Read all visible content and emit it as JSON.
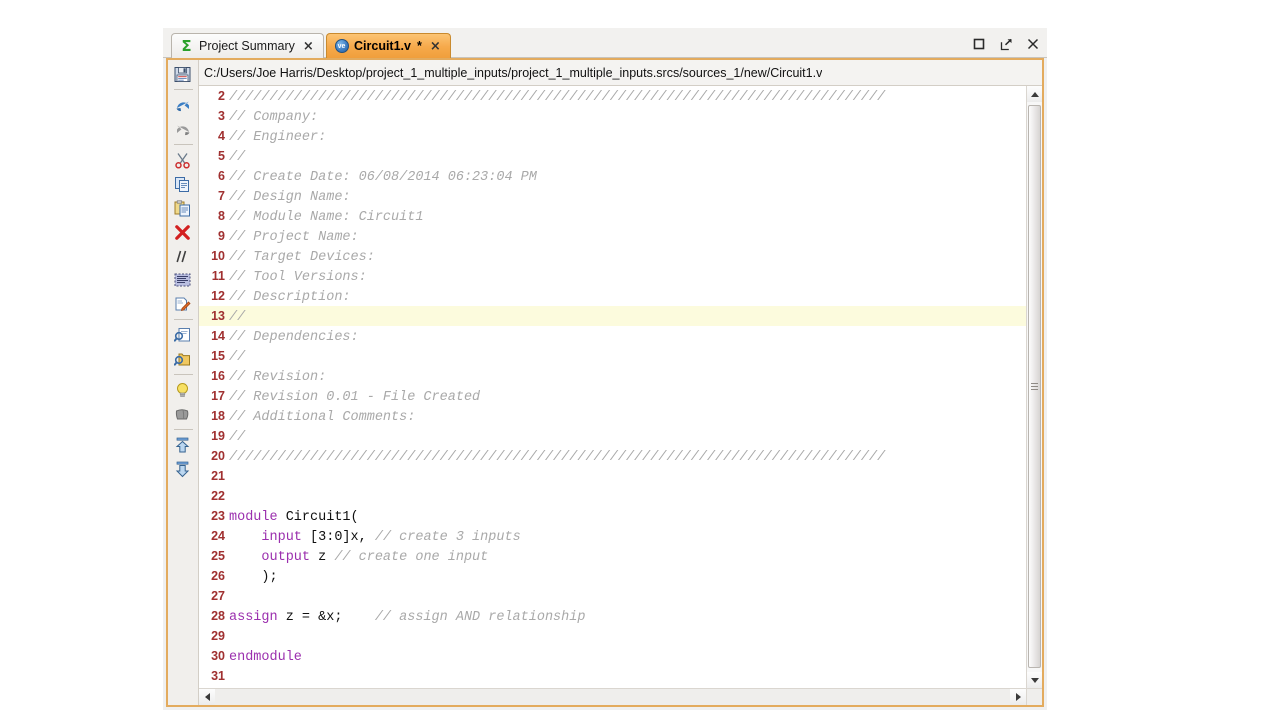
{
  "window": {
    "controls": [
      {
        "name": "maximize",
        "glyph": "maximize-icon"
      },
      {
        "name": "float",
        "glyph": "float-icon"
      },
      {
        "name": "close",
        "glyph": "close-icon"
      }
    ]
  },
  "tabs": [
    {
      "label": "Project Summary",
      "icon": "sigma-icon",
      "dirty": "",
      "close": "×",
      "active": false
    },
    {
      "label": "Circuit1.v",
      "icon": "verilog-icon",
      "icon_text": "ve",
      "dirty": "*",
      "close": "×",
      "active": true
    }
  ],
  "path_bar": {
    "path": "C:/Users/Joe Harris/Desktop/project_1_multiple_inputs/project_1_multiple_inputs.srcs/sources_1/new/Circuit1.v",
    "save_icon": "save-icon"
  },
  "side_toolbar": {
    "items": [
      "undo-icon",
      "redo-icon",
      "cut-icon",
      "copy-icon",
      "paste-icon",
      "delete-icon",
      "comment-icon",
      "block-select-icon",
      "edit-icon",
      "find-icon",
      "find-in-files-icon",
      "hint-icon",
      "eraser-icon",
      "collapse-all-icon",
      "expand-all-icon"
    ]
  },
  "colors": {
    "accent_tab": "#f6a94a",
    "panel_border": "#e3ab5e",
    "line_number": "#a03030",
    "comment": "#a9a9a9",
    "keyword": "#9b2fae",
    "plain": "#101010",
    "current_line_highlight": "#fcfbdd",
    "verilog_icon": "#3f7fc4",
    "sigma_icon": "#2aa02a"
  },
  "editor": {
    "language": "verilog",
    "current_line": 13,
    "first_visible_line": 2,
    "last_visible_line": 31,
    "lines": [
      {
        "n": 2,
        "tokens": [
          {
            "t": "cmt",
            "s": "/////////////////////////////////////////////////////////////////////////////////"
          }
        ]
      },
      {
        "n": 3,
        "tokens": [
          {
            "t": "cmt",
            "s": "// Company: "
          }
        ]
      },
      {
        "n": 4,
        "tokens": [
          {
            "t": "cmt",
            "s": "// Engineer: "
          }
        ]
      },
      {
        "n": 5,
        "tokens": [
          {
            "t": "cmt",
            "s": "// "
          }
        ]
      },
      {
        "n": 6,
        "tokens": [
          {
            "t": "cmt",
            "s": "// Create Date: 06/08/2014 06:23:04 PM"
          }
        ]
      },
      {
        "n": 7,
        "tokens": [
          {
            "t": "cmt",
            "s": "// Design Name: "
          }
        ]
      },
      {
        "n": 8,
        "tokens": [
          {
            "t": "cmt",
            "s": "// Module Name: Circuit1"
          }
        ]
      },
      {
        "n": 9,
        "tokens": [
          {
            "t": "cmt",
            "s": "// Project Name: "
          }
        ]
      },
      {
        "n": 10,
        "tokens": [
          {
            "t": "cmt",
            "s": "// Target Devices: "
          }
        ]
      },
      {
        "n": 11,
        "tokens": [
          {
            "t": "cmt",
            "s": "// Tool Versions: "
          }
        ]
      },
      {
        "n": 12,
        "tokens": [
          {
            "t": "cmt",
            "s": "// Description: "
          }
        ]
      },
      {
        "n": 13,
        "tokens": [
          {
            "t": "cmt",
            "s": "// "
          }
        ]
      },
      {
        "n": 14,
        "tokens": [
          {
            "t": "cmt",
            "s": "// Dependencies: "
          }
        ]
      },
      {
        "n": 15,
        "tokens": [
          {
            "t": "cmt",
            "s": "// "
          }
        ]
      },
      {
        "n": 16,
        "tokens": [
          {
            "t": "cmt",
            "s": "// Revision:"
          }
        ]
      },
      {
        "n": 17,
        "tokens": [
          {
            "t": "cmt",
            "s": "// Revision 0.01 - File Created"
          }
        ]
      },
      {
        "n": 18,
        "tokens": [
          {
            "t": "cmt",
            "s": "// Additional Comments:"
          }
        ]
      },
      {
        "n": 19,
        "tokens": [
          {
            "t": "cmt",
            "s": "// "
          }
        ]
      },
      {
        "n": 20,
        "tokens": [
          {
            "t": "cmt",
            "s": "/////////////////////////////////////////////////////////////////////////////////"
          }
        ]
      },
      {
        "n": 21,
        "tokens": []
      },
      {
        "n": 22,
        "tokens": []
      },
      {
        "n": 23,
        "tokens": [
          {
            "t": "kw",
            "s": "module"
          },
          {
            "t": "pln",
            "s": " Circuit1("
          }
        ]
      },
      {
        "n": 24,
        "tokens": [
          {
            "t": "pln",
            "s": "    "
          },
          {
            "t": "kw",
            "s": "input"
          },
          {
            "t": "pln",
            "s": " [3:0]x, "
          },
          {
            "t": "cmt",
            "s": "// create 3 inputs"
          }
        ]
      },
      {
        "n": 25,
        "tokens": [
          {
            "t": "pln",
            "s": "    "
          },
          {
            "t": "kw",
            "s": "output"
          },
          {
            "t": "pln",
            "s": " z "
          },
          {
            "t": "cmt",
            "s": "// create one input"
          }
        ]
      },
      {
        "n": 26,
        "tokens": [
          {
            "t": "pln",
            "s": "    );"
          }
        ]
      },
      {
        "n": 27,
        "tokens": []
      },
      {
        "n": 28,
        "tokens": [
          {
            "t": "kw",
            "s": "assign"
          },
          {
            "t": "pln",
            "s": " z = &x;    "
          },
          {
            "t": "cmt",
            "s": "// assign AND relationship"
          }
        ]
      },
      {
        "n": 29,
        "tokens": []
      },
      {
        "n": 30,
        "tokens": [
          {
            "t": "kw",
            "s": "endmodule"
          }
        ]
      },
      {
        "n": 31,
        "tokens": []
      }
    ]
  }
}
